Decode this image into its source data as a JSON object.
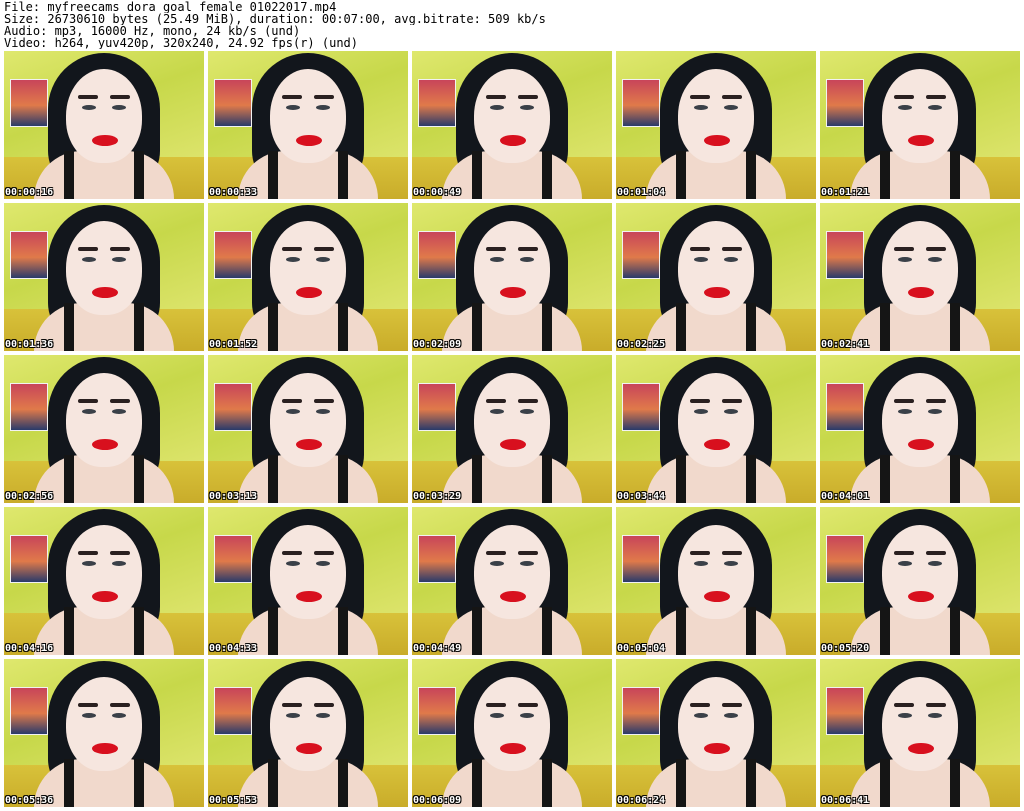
{
  "header": {
    "lines": [
      "File: myfreecams_dora_goal_female_01022017.mp4",
      "Size: 26730610 bytes (25.49 MiB), duration: 00:07:00, avg.bitrate: 509 kb/s",
      "Audio: mp3, 16000 Hz, mono, 24 kb/s (und)",
      "Video: h264, yuv420p, 320x240, 24.92 fps(r) (und)"
    ]
  },
  "thumbnails": [
    {
      "timestamp": "00:00:16"
    },
    {
      "timestamp": "00:00:33"
    },
    {
      "timestamp": "00:00:49"
    },
    {
      "timestamp": "00:01:04"
    },
    {
      "timestamp": "00:01:21"
    },
    {
      "timestamp": "00:01:36"
    },
    {
      "timestamp": "00:01:52"
    },
    {
      "timestamp": "00:02:09"
    },
    {
      "timestamp": "00:02:25"
    },
    {
      "timestamp": "00:02:41"
    },
    {
      "timestamp": "00:02:56"
    },
    {
      "timestamp": "00:03:13"
    },
    {
      "timestamp": "00:03:29"
    },
    {
      "timestamp": "00:03:44"
    },
    {
      "timestamp": "00:04:01"
    },
    {
      "timestamp": "00:04:16"
    },
    {
      "timestamp": "00:04:33"
    },
    {
      "timestamp": "00:04:49"
    },
    {
      "timestamp": "00:05:04"
    },
    {
      "timestamp": "00:05:20"
    },
    {
      "timestamp": "00:05:36"
    },
    {
      "timestamp": "00:05:53"
    },
    {
      "timestamp": "00:06:09"
    },
    {
      "timestamp": "00:06:24"
    },
    {
      "timestamp": "00:06:41"
    }
  ]
}
